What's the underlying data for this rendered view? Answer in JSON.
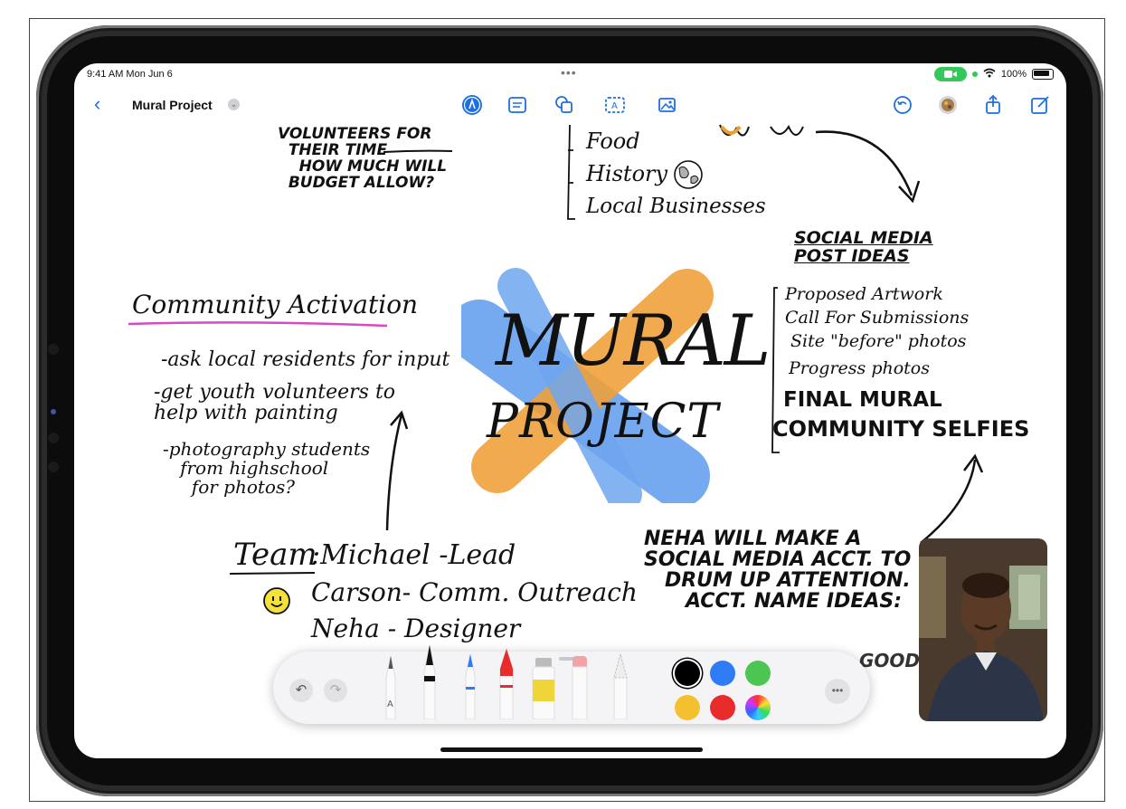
{
  "status_bar": {
    "time": "9:41 AM  Mon Jun 6",
    "center_dots": "•••",
    "battery_percent": "100%",
    "wifi_icon": "wifi-icon"
  },
  "toolbar": {
    "title": "Mural Project",
    "back_icon": "chevron-left-icon",
    "title_menu_icon": "chevron-down-icon",
    "center_tools": [
      "pen-tool-icon",
      "note-icon",
      "shapes-icon",
      "text-box-icon",
      "photo-icon"
    ],
    "right_tools": [
      "undo-history-icon",
      "collaborators-icon",
      "share-icon",
      "compose-icon"
    ]
  },
  "canvas": {
    "top_left_note": "VOLUNTEERS FOR\n  THEIR TIME\n    HOW MUCH WILL\n  BUDGET ALLOW?",
    "topic_list": [
      "Food",
      "History",
      "Local Businesses"
    ],
    "mural_line1": "MURAL",
    "mural_line2": "PROJECT",
    "community_heading": "Community Activation",
    "community_items": [
      "-ask local residents for input",
      "-get youth volunteers to\nhelp with painting",
      "-photography students\n   from highschool\n     for photos?"
    ],
    "team_label": "Team",
    "team_members": [
      ":Michael -Lead",
      "Carson- Comm. Outreach",
      "Neha - Designer"
    ],
    "social_heading": "SOCIAL MEDIA\nPOST IDEAS",
    "social_items": [
      "Proposed Artwork",
      "Call For Submissions",
      "Site \"before\" photos",
      "Progress photos"
    ],
    "social_items_bold": [
      "FINAL MURAL",
      "COMMUNITY SELFIES"
    ],
    "neha_note": "NEHA WILL MAKE A\nSOCIAL MEDIA ACCT. TO\n   DRUM UP ATTENTION.\n      ACCT. NAME IDEAS:",
    "partial_text": "GOOD"
  },
  "palette": {
    "undo_label": "↶",
    "redo_label": "↷",
    "tools": [
      "monoline-pen",
      "fountain-pen",
      "marker",
      "crayon",
      "paint-bucket",
      "eraser",
      "pencil"
    ],
    "pen_letter": "A",
    "colors": [
      "#000000",
      "#2f7bf5",
      "#4cc552",
      "#f5c02f",
      "#e82c2c",
      "color-wheel"
    ],
    "more_label": "•••"
  },
  "facetime": {
    "participant": "video-call-participant"
  }
}
